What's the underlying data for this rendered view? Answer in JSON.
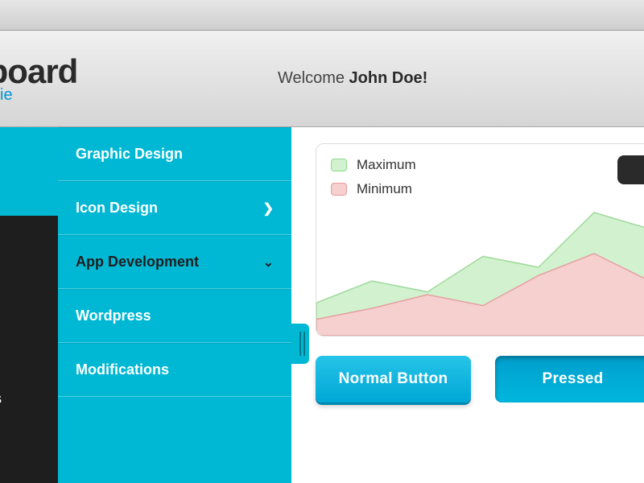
{
  "header": {
    "title": "hboard",
    "subtitle": "reebie",
    "welcome_prefix": "Welcome ",
    "welcome_name": "John Doe!"
  },
  "left_nav": {
    "projects_label": "CTS"
  },
  "submenu": {
    "items": [
      {
        "label": "Graphic Design",
        "icon": ""
      },
      {
        "label": "Icon Design",
        "icon": "chevron-right"
      },
      {
        "label": "App Development",
        "icon": "chevron-down",
        "dark": true
      },
      {
        "label": "Wordpress",
        "icon": ""
      },
      {
        "label": "Modifications",
        "icon": ""
      }
    ]
  },
  "chart": {
    "legend": {
      "max": "Maximum",
      "min": "Minimum"
    }
  },
  "chart_data": {
    "type": "area",
    "x": [
      0,
      1,
      2,
      3,
      4,
      5,
      6
    ],
    "series": [
      {
        "name": "Maximum",
        "values": [
          24,
          40,
          32,
          58,
          50,
          90,
          78
        ],
        "color": "#d2f2cf"
      },
      {
        "name": "Minimum",
        "values": [
          12,
          20,
          30,
          22,
          44,
          60,
          40
        ],
        "color": "#f6cfcf"
      }
    ],
    "ylim": [
      0,
      100
    ],
    "title": "",
    "xlabel": "",
    "ylabel": ""
  },
  "buttons": {
    "normal": "Normal Button",
    "pressed": "Pressed"
  },
  "colors": {
    "accent": "#00b8d4",
    "dark": "#1e1e1e"
  }
}
